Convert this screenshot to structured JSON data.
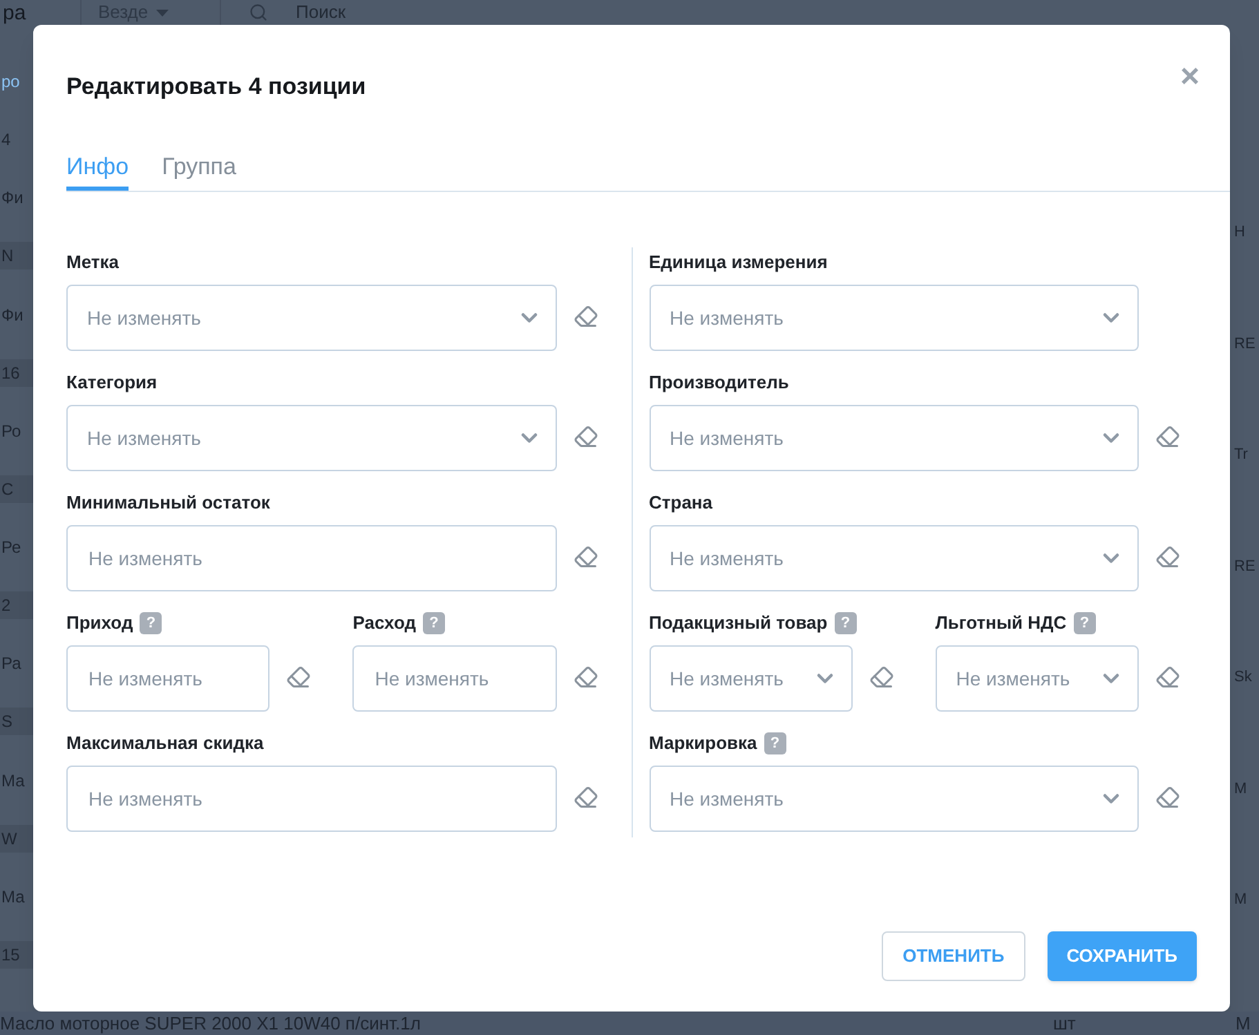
{
  "background": {
    "header": {
      "logo_fragment": "ра",
      "scope": "Везде",
      "search_placeholder": "Поиск"
    },
    "left_fragments": [
      {
        "text": "ро",
        "kind": "link"
      },
      {
        "text": "4",
        "kind": "label"
      },
      {
        "text": "Фи",
        "kind": "label"
      },
      {
        "text": "N",
        "kind": "value"
      },
      {
        "text": "Фи",
        "kind": "label"
      },
      {
        "text": "16",
        "kind": "value"
      },
      {
        "text": "Ро",
        "kind": "label"
      },
      {
        "text": "С",
        "kind": "value"
      },
      {
        "text": "Ре",
        "kind": "label"
      },
      {
        "text": "2",
        "kind": "value"
      },
      {
        "text": "Ра",
        "kind": "label"
      },
      {
        "text": "S",
        "kind": "value"
      },
      {
        "text": "Ма",
        "kind": "label"
      },
      {
        "text": "W",
        "kind": "value"
      },
      {
        "text": "Ма",
        "kind": "label"
      },
      {
        "text": "15",
        "kind": "value"
      }
    ],
    "right_fragments": [
      "Н",
      "RE",
      "Tr",
      "RE",
      "Sk",
      "M",
      "M"
    ],
    "bottom_row": {
      "name": "Масло моторное SUPER 2000 X1 10W40 п/синт.1л",
      "unit": "шт",
      "column_3": "M"
    }
  },
  "dialog": {
    "title": "Редактировать 4 позиции",
    "close": "×",
    "tabs": [
      {
        "label": "Инфо",
        "selected": true
      },
      {
        "label": "Группа",
        "selected": false
      }
    ],
    "columns": [
      {
        "rows": [
          {
            "fields": [
              {
                "label": "Метка",
                "kind": "select",
                "placeholder": "Не изменять",
                "clearable": true
              }
            ]
          },
          {
            "fields": [
              {
                "label": "Категория",
                "kind": "select",
                "placeholder": "Не изменять",
                "clearable": true
              }
            ]
          },
          {
            "fields": [
              {
                "label": "Минимальный остаток",
                "kind": "input",
                "placeholder": "Не изменять",
                "clearable": true
              }
            ]
          },
          {
            "fields": [
              {
                "label": "Приход",
                "help": "?",
                "kind": "input",
                "placeholder": "Не изменять",
                "clearable": true
              },
              {
                "label": "Расход",
                "help": "?",
                "kind": "input",
                "placeholder": "Не изменять",
                "clearable": true
              }
            ]
          },
          {
            "fields": [
              {
                "label": "Максимальная скидка",
                "kind": "input",
                "placeholder": "Не изменять",
                "clearable": true
              }
            ]
          }
        ]
      },
      {
        "rows": [
          {
            "fields": [
              {
                "label": "Единица измерения",
                "kind": "select",
                "placeholder": "Не изменять",
                "clearable": false
              }
            ]
          },
          {
            "fields": [
              {
                "label": "Производитель",
                "kind": "select",
                "placeholder": "Не изменять",
                "clearable": true
              }
            ]
          },
          {
            "fields": [
              {
                "label": "Страна",
                "kind": "select",
                "placeholder": "Не изменять",
                "clearable": true
              }
            ]
          },
          {
            "fields": [
              {
                "label": "Подакцизный товар",
                "help": "?",
                "kind": "select",
                "placeholder": "Не изменять",
                "clearable": true
              },
              {
                "label": "Льготный НДС",
                "help": "?",
                "kind": "select",
                "placeholder": "Не изменять",
                "clearable": true
              }
            ]
          },
          {
            "fields": [
              {
                "label": "Маркировка",
                "help": "?",
                "kind": "select",
                "placeholder": "Не изменять",
                "clearable": true
              }
            ]
          }
        ]
      }
    ],
    "buttons": [
      {
        "label": "ОТМЕНИТЬ",
        "kind": "secondary"
      },
      {
        "label": "СОХРАНИТЬ",
        "kind": "primary"
      }
    ]
  }
}
